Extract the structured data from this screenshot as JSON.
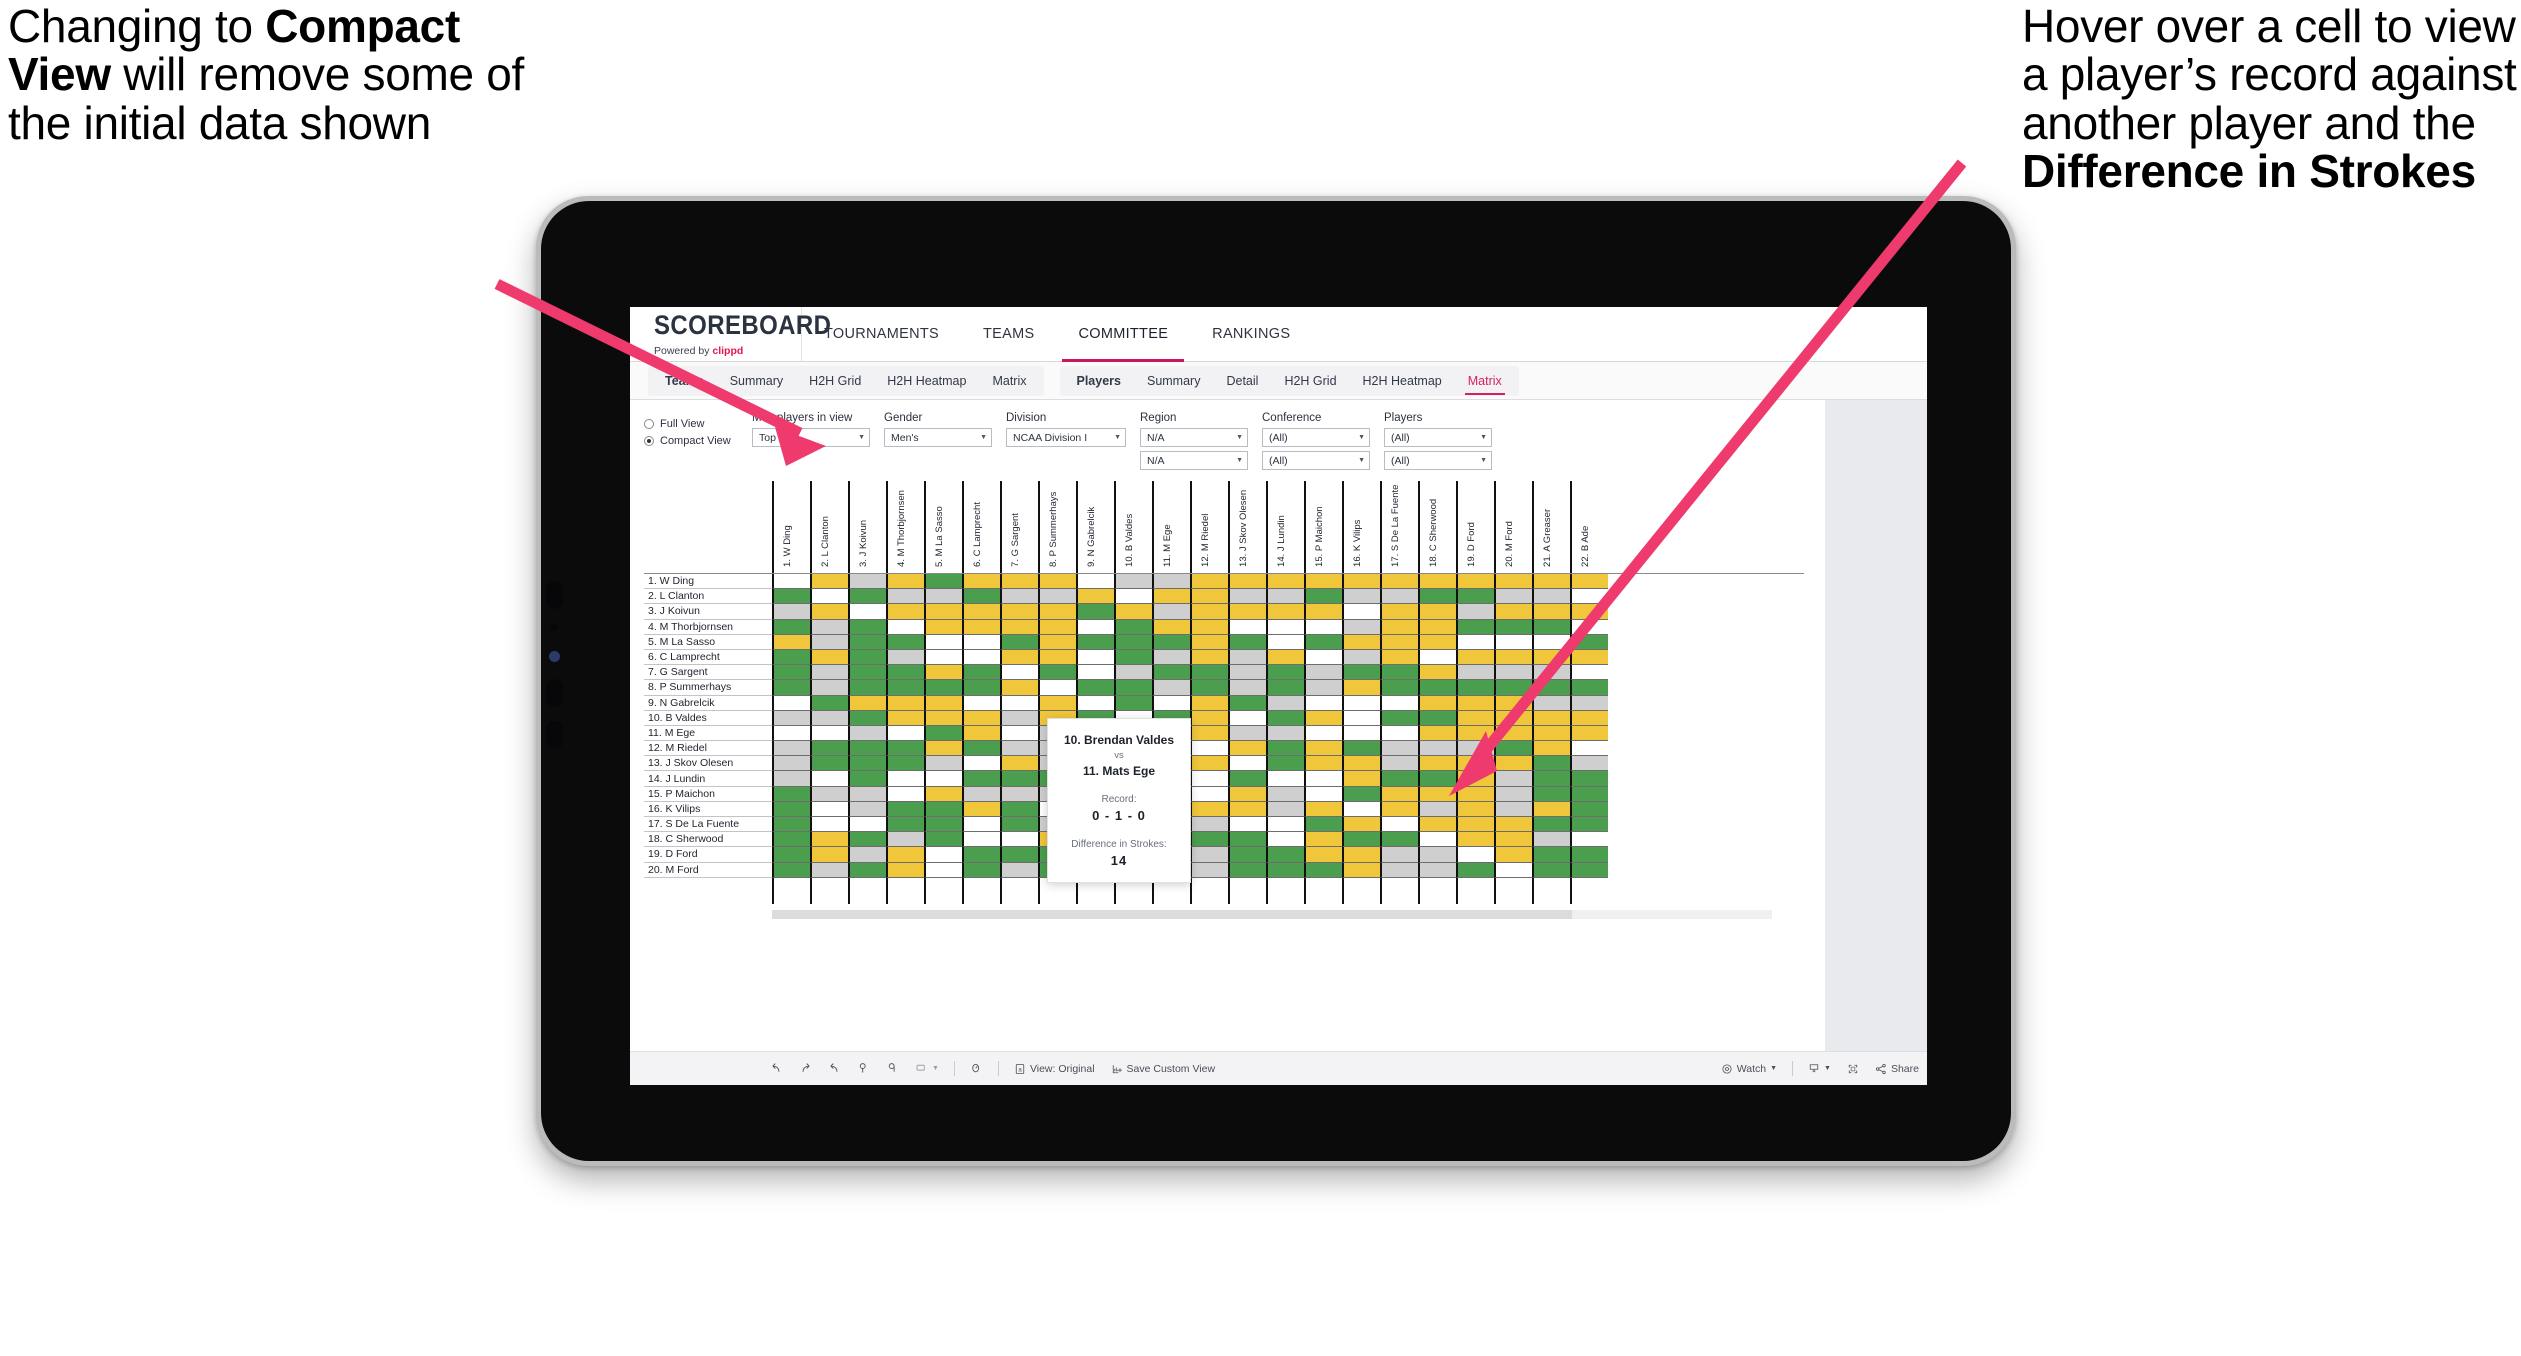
{
  "annotations": {
    "left": {
      "line1": "Changing to ",
      "bold1": "Compact View",
      "line2": " will remove some of the initial data shown"
    },
    "right": {
      "line1": "Hover over a cell to view a player’s record against another player and the ",
      "bold1": "Difference in Strokes"
    }
  },
  "brand": {
    "title": "SCOREBOARD",
    "powered_by": "Powered by ",
    "vendor": "clippd"
  },
  "topnav": {
    "items": [
      {
        "label": "TOURNAMENTS",
        "active": false
      },
      {
        "label": "TEAMS",
        "active": false
      },
      {
        "label": "COMMITTEE",
        "active": true
      },
      {
        "label": "RANKINGS",
        "active": false
      }
    ]
  },
  "subnav": {
    "teams_group": {
      "head": "Teams",
      "items": [
        "Summary",
        "H2H Grid",
        "H2H Heatmap",
        "Matrix"
      ],
      "active": ""
    },
    "players_group": {
      "head": "Players",
      "items": [
        "Summary",
        "Detail",
        "H2H Grid",
        "H2H Heatmap",
        "Matrix"
      ],
      "active": "Matrix"
    }
  },
  "filters": {
    "view_mode": {
      "full_label": "Full View",
      "compact_label": "Compact View",
      "selected": "Compact View"
    },
    "fields": [
      {
        "label": "Max players in view",
        "value": "Top 25",
        "width": "w-maxp",
        "second": null
      },
      {
        "label": "Gender",
        "value": "Men's",
        "width": "w-gender",
        "second": null
      },
      {
        "label": "Division",
        "value": "NCAA Division I",
        "width": "w-div",
        "second": null
      },
      {
        "label": "Region",
        "value": "N/A",
        "width": "w-region",
        "second": "N/A"
      },
      {
        "label": "Conference",
        "value": "(All)",
        "width": "w-conf",
        "second": "(All)"
      },
      {
        "label": "Players",
        "value": "(All)",
        "width": "w-players",
        "second": "(All)"
      }
    ]
  },
  "matrix": {
    "column_headers": [
      "1. W Ding",
      "2. L Clanton",
      "3. J Koivun",
      "4. M Thorbjornsen",
      "5. M La Sasso",
      "6. C Lamprecht",
      "7. G Sargent",
      "8. P Summerhays",
      "9. N Gabrelcik",
      "10. B Valdes",
      "11. M Ege",
      "12. M Riedel",
      "13. J Skov Olesen",
      "14. J Lundin",
      "15. P Maichon",
      "16. K Vilips",
      "17. S De La Fuente",
      "18. C Sherwood",
      "19. D Ford",
      "20. M Ford",
      "21. A Greaser",
      "22. B Ade"
    ],
    "row_labels": [
      "1. W Ding",
      "2. L Clanton",
      "3. J Koivun",
      "4. M Thorbjornsen",
      "5. M La Sasso",
      "6. C Lamprecht",
      "7. G Sargent",
      "8. P Summerhays",
      "9. N Gabrelcik",
      "10. B Valdes",
      "11. M Ege",
      "12. M Riedel",
      "13. J Skov Olesen",
      "14. J Lundin",
      "15. P Maichon",
      "16. K Vilips",
      "17. S De La Fuente",
      "18. C Sherwood",
      "19. D Ford",
      "20. M Ford"
    ],
    "legend_colors": {
      "win": "#4c9e4f",
      "tie": "#f0c63b",
      "loss": "#cfcfcf",
      "none": "#ffffff"
    },
    "cells": [
      [
        "w",
        "y",
        "a",
        "y",
        "g",
        "y",
        "y",
        "y",
        "w",
        "a",
        "a",
        "y",
        "y",
        "y",
        "y",
        "y",
        "y",
        "y",
        "y",
        "y",
        "y",
        "y"
      ],
      [
        "g",
        "w",
        "g",
        "a",
        "a",
        "g",
        "a",
        "a",
        "y",
        "w",
        "y",
        "y",
        "a",
        "a",
        "g",
        "a",
        "a",
        "g",
        "g",
        "a",
        "a",
        "w"
      ],
      [
        "a",
        "y",
        "w",
        "y",
        "y",
        "y",
        "y",
        "y",
        "g",
        "y",
        "a",
        "y",
        "y",
        "y",
        "y",
        "w",
        "y",
        "y",
        "a",
        "y",
        "y",
        "y"
      ],
      [
        "g",
        "a",
        "g",
        "w",
        "y",
        "y",
        "y",
        "y",
        "w",
        "g",
        "y",
        "y",
        "w",
        "w",
        "w",
        "a",
        "y",
        "y",
        "g",
        "g",
        "g",
        "w"
      ],
      [
        "y",
        "a",
        "g",
        "g",
        "w",
        "w",
        "g",
        "y",
        "g",
        "g",
        "g",
        "y",
        "g",
        "w",
        "g",
        "y",
        "y",
        "y",
        "w",
        "w",
        "w",
        "g"
      ],
      [
        "g",
        "y",
        "g",
        "a",
        "w",
        "w",
        "y",
        "y",
        "w",
        "g",
        "a",
        "y",
        "a",
        "y",
        "w",
        "a",
        "y",
        "w",
        "y",
        "y",
        "y",
        "y"
      ],
      [
        "g",
        "a",
        "g",
        "g",
        "y",
        "g",
        "w",
        "g",
        "w",
        "a",
        "g",
        "g",
        "a",
        "g",
        "a",
        "g",
        "g",
        "y",
        "a",
        "a",
        "a",
        "w"
      ],
      [
        "g",
        "a",
        "g",
        "g",
        "g",
        "g",
        "y",
        "w",
        "g",
        "g",
        "a",
        "g",
        "a",
        "g",
        "a",
        "y",
        "g",
        "g",
        "g",
        "g",
        "g",
        "g"
      ],
      [
        "w",
        "g",
        "y",
        "y",
        "y",
        "w",
        "w",
        "y",
        "w",
        "g",
        "w",
        "y",
        "g",
        "a",
        "w",
        "w",
        "w",
        "y",
        "y",
        "y",
        "a",
        "a"
      ],
      [
        "a",
        "a",
        "g",
        "y",
        "y",
        "y",
        "a",
        "y",
        "g",
        "w",
        "g",
        "y",
        "w",
        "g",
        "y",
        "w",
        "g",
        "g",
        "y",
        "y",
        "y",
        "y"
      ],
      [
        "w",
        "w",
        "a",
        "w",
        "g",
        "y",
        "w",
        "a",
        "y",
        "w",
        "w",
        "y",
        "a",
        "a",
        "w",
        "w",
        "w",
        "y",
        "y",
        "y",
        "y",
        "y"
      ],
      [
        "a",
        "g",
        "g",
        "g",
        "y",
        "g",
        "a",
        "a",
        "a",
        "a",
        "w",
        "w",
        "y",
        "g",
        "y",
        "g",
        "a",
        "a",
        "a",
        "g",
        "y",
        "w"
      ],
      [
        "a",
        "g",
        "g",
        "g",
        "a",
        "w",
        "y",
        "a",
        "y",
        "a",
        "w",
        "y",
        "w",
        "g",
        "y",
        "y",
        "a",
        "y",
        "y",
        "y",
        "g",
        "a"
      ],
      [
        "a",
        "w",
        "g",
        "w",
        "w",
        "g",
        "g",
        "g",
        "a",
        "g",
        "w",
        "w",
        "g",
        "w",
        "w",
        "y",
        "g",
        "g",
        "y",
        "a",
        "g",
        "g"
      ],
      [
        "g",
        "a",
        "a",
        "w",
        "y",
        "a",
        "a",
        "a",
        "a",
        "w",
        "g",
        "w",
        "y",
        "a",
        "w",
        "g",
        "y",
        "y",
        "y",
        "a",
        "g",
        "g"
      ],
      [
        "g",
        "w",
        "a",
        "g",
        "g",
        "y",
        "g",
        "w",
        "g",
        "a",
        "w",
        "y",
        "y",
        "a",
        "y",
        "w",
        "y",
        "a",
        "y",
        "a",
        "y",
        "g"
      ],
      [
        "g",
        "w",
        "w",
        "g",
        "g",
        "w",
        "g",
        "a",
        "g",
        "g",
        "a",
        "a",
        "w",
        "w",
        "g",
        "y",
        "w",
        "y",
        "y",
        "y",
        "g",
        "g"
      ],
      [
        "g",
        "y",
        "g",
        "a",
        "g",
        "w",
        "w",
        "y",
        "g",
        "y",
        "y",
        "g",
        "g",
        "w",
        "y",
        "g",
        "g",
        "w",
        "y",
        "y",
        "a",
        "w"
      ],
      [
        "g",
        "y",
        "a",
        "y",
        "w",
        "g",
        "g",
        "g",
        "g",
        "a",
        "g",
        "a",
        "g",
        "g",
        "y",
        "y",
        "a",
        "a",
        "w",
        "y",
        "g",
        "g"
      ],
      [
        "g",
        "a",
        "g",
        "y",
        "w",
        "g",
        "a",
        "g",
        "w",
        "g",
        "a",
        "a",
        "g",
        "g",
        "g",
        "y",
        "a",
        "a",
        "g",
        "w",
        "g",
        "g"
      ]
    ]
  },
  "tooltip": {
    "player_a": "10. Brendan Valdes",
    "vs": "vs",
    "player_b": "11. Mats Ege",
    "record_label": "Record:",
    "record_value": "0 - 1 - 0",
    "strokes_label": "Difference in Strokes:",
    "strokes_value": "14"
  },
  "toolbar": {
    "view_original": "View: Original",
    "save_custom_view": "Save Custom View",
    "watch": "Watch",
    "share": "Share"
  },
  "colors": {
    "accent": "#d71e63",
    "arrow": "#ef3a6e",
    "vendor": "#e8144e"
  }
}
